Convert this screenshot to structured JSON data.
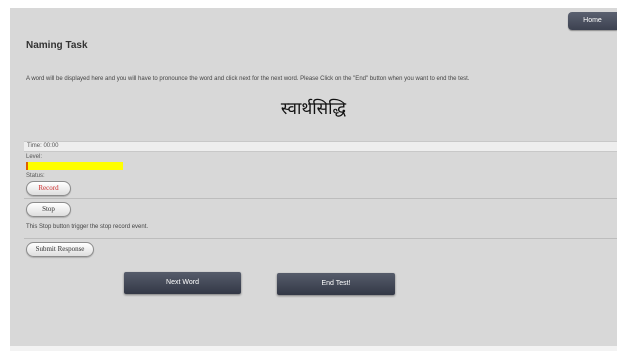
{
  "header": {
    "home_label": "Home"
  },
  "task": {
    "title": "Naming Task",
    "instructions": "A word will be displayed here and you will have to pronounce the word and click next for the next word. Please Click on the \"End\" button when you want to end the test.",
    "word": "स्वार्थसिद्धि"
  },
  "recorder": {
    "time_text": "Time: 00:00",
    "level_label": "Level:",
    "level_value": 0.16,
    "status_label": "Status:",
    "record_label": "Record",
    "stop_label": "Stop",
    "stop_note": "This Stop button trigger the stop record event."
  },
  "actions": {
    "submit_label": "Submit Response",
    "next_label": "Next Word",
    "end_label": "End Test!"
  },
  "colors": {
    "level_fill": "#ffff00",
    "record_text": "#d03030",
    "dark_button": "#3c4150",
    "page_background": "#d8d8d8"
  }
}
